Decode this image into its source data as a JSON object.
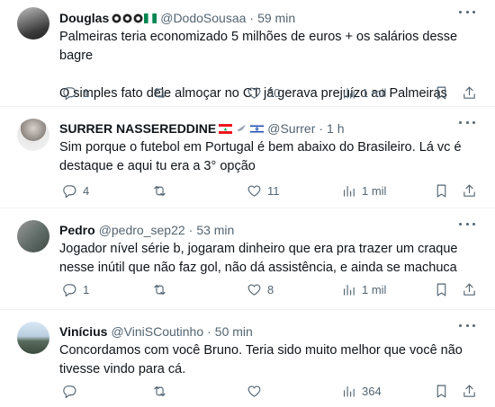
{
  "tweets": [
    {
      "name": "Douglas",
      "handle": "@DodoSousaa",
      "time": "59 min",
      "paragraphs": [
        "Palmeiras teria economizado 5 milhões de euros + os salários desse bagre",
        "O simples fato dele almoçar no CT já gerava prejuízo ao Palmeiras"
      ],
      "replies": "1",
      "retweets": "",
      "likes": "50",
      "views": "1 mil"
    },
    {
      "name": "SURRER NASSEREDDINE",
      "handle": "@Surrer",
      "time": "1 h",
      "paragraphs": [
        "Sim porque o futebol em Portugal é bem abaixo do Brasileiro. Lá vc é destaque e aqui tu era a 3° opção"
      ],
      "replies": "4",
      "retweets": "",
      "likes": "11",
      "views": "1 mil"
    },
    {
      "name": "Pedro",
      "handle": "@pedro_sep22",
      "time": "53 min",
      "paragraphs": [
        "Jogador nível série b, jogaram dinheiro que era pra trazer um craque nesse inútil que não faz gol, não dá assistência, e ainda se machuca"
      ],
      "replies": "1",
      "retweets": "",
      "likes": "8",
      "views": "1 mil"
    },
    {
      "name": "Vinícius",
      "handle": "@ViniSCoutinho",
      "time": "50 min",
      "paragraphs": [
        "Concordamos com você Bruno. Teria sido muito melhor que você não tivesse vindo para cá."
      ],
      "replies": "",
      "retweets": "",
      "likes": "",
      "views": "364"
    }
  ],
  "separator": "·",
  "icons": [
    "reply-icon",
    "retweet-icon",
    "like-icon",
    "views-icon",
    "bookmark-icon",
    "share-icon",
    "more-icon"
  ],
  "colors": {
    "text": "#0f1419",
    "secondary": "#536471",
    "border": "#eff3f4"
  }
}
